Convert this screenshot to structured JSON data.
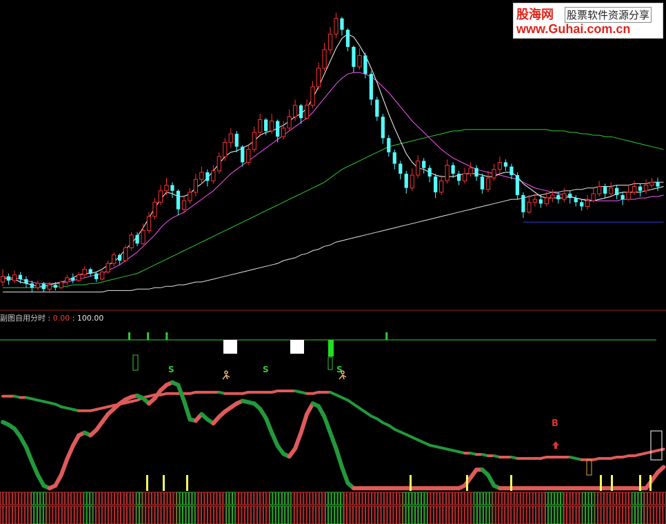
{
  "watermark": {
    "logo": "股海网",
    "slogan": "股票软件资源分享",
    "url": "www.Guhai.com.cn"
  },
  "sub_panel": {
    "name": "副图自用分时",
    "range_low": "0.00",
    "range_high": "100.00",
    "markers": {
      "buy": "B",
      "sell": "S"
    }
  },
  "colors": {
    "background": "#000000",
    "up_candle": "#ff3232",
    "down_candle": "#54fcfc",
    "ma_short": "#ffffff",
    "ma_mid": "#ff55ff",
    "ma_long": "#33cc33",
    "ma_longest": "#e6e6e6",
    "support_line": "#3333cc",
    "kdj_up": "#e05a5a",
    "kdj_down": "#22993a",
    "signal_bar": "#ffff66",
    "panel_divider": "#992222"
  },
  "chart_data": {
    "type": "candlestick",
    "candles": [
      [
        12.0,
        12.4,
        12.9,
        11.7
      ],
      [
        12.4,
        12.1,
        12.6,
        11.8
      ],
      [
        12.1,
        12.5,
        12.8,
        11.9
      ],
      [
        12.5,
        12.2,
        12.7,
        11.9
      ],
      [
        12.2,
        11.9,
        12.4,
        11.6
      ],
      [
        11.9,
        11.6,
        12.1,
        11.3
      ],
      [
        11.6,
        11.9,
        12.1,
        11.4
      ],
      [
        11.9,
        11.5,
        12.0,
        11.3
      ],
      [
        11.5,
        11.8,
        12.0,
        11.2
      ],
      [
        11.8,
        11.6,
        12.0,
        11.4
      ],
      [
        11.6,
        12.0,
        12.1,
        11.5
      ],
      [
        12.0,
        12.3,
        12.5,
        11.8
      ],
      [
        12.3,
        12.1,
        12.6,
        11.9
      ],
      [
        12.1,
        12.5,
        12.7,
        12.0
      ],
      [
        12.5,
        12.9,
        13.1,
        12.3
      ],
      [
        12.9,
        12.6,
        13.0,
        12.4
      ],
      [
        12.6,
        12.2,
        12.7,
        12.0
      ],
      [
        12.2,
        12.7,
        12.8,
        12.1
      ],
      [
        12.7,
        13.3,
        13.5,
        12.6
      ],
      [
        13.3,
        13.9,
        14.1,
        13.1
      ],
      [
        13.9,
        13.5,
        14.0,
        13.2
      ],
      [
        13.5,
        14.4,
        14.6,
        13.4
      ],
      [
        14.4,
        15.3,
        15.5,
        14.2
      ],
      [
        15.3,
        14.7,
        15.5,
        14.5
      ],
      [
        14.7,
        15.6,
        16.1,
        14.6
      ],
      [
        15.6,
        16.6,
        16.9,
        15.4
      ],
      [
        16.6,
        17.6,
        17.9,
        16.4
      ],
      [
        17.6,
        18.4,
        18.8,
        17.4
      ],
      [
        18.4,
        18.8,
        19.3,
        18.1
      ],
      [
        18.8,
        18.4,
        19.0,
        17.9
      ],
      [
        18.4,
        17.1,
        18.5,
        16.7
      ],
      [
        17.1,
        17.7,
        18.1,
        16.8
      ],
      [
        17.7,
        18.3,
        18.6,
        17.5
      ],
      [
        18.3,
        19.2,
        19.6,
        18.0
      ],
      [
        19.2,
        19.7,
        20.1,
        18.9
      ],
      [
        19.7,
        19.1,
        19.9,
        18.7
      ],
      [
        19.1,
        19.8,
        20.2,
        18.9
      ],
      [
        19.8,
        20.8,
        21.1,
        19.6
      ],
      [
        20.8,
        21.8,
        22.1,
        20.5
      ],
      [
        21.8,
        22.4,
        22.8,
        21.4
      ],
      [
        22.4,
        21.5,
        22.6,
        21.1
      ],
      [
        21.5,
        20.4,
        21.6,
        20.1
      ],
      [
        20.4,
        21.3,
        21.6,
        20.2
      ],
      [
        21.3,
        22.5,
        22.9,
        21.1
      ],
      [
        22.5,
        23.4,
        23.8,
        22.3
      ],
      [
        23.4,
        22.6,
        23.5,
        22.3
      ],
      [
        22.6,
        23.3,
        23.8,
        22.4
      ],
      [
        23.3,
        22.2,
        23.4,
        21.8
      ],
      [
        22.2,
        22.8,
        23.3,
        22.0
      ],
      [
        22.8,
        23.6,
        24.1,
        22.6
      ],
      [
        23.6,
        24.4,
        24.8,
        23.3
      ],
      [
        24.4,
        23.5,
        24.5,
        23.1
      ],
      [
        23.5,
        24.4,
        24.8,
        23.4
      ],
      [
        24.4,
        25.7,
        26.1,
        24.2
      ],
      [
        25.7,
        27.0,
        27.4,
        25.5
      ],
      [
        27.0,
        28.3,
        28.8,
        26.8
      ],
      [
        28.3,
        29.4,
        29.9,
        28.0
      ],
      [
        29.4,
        30.5,
        30.9,
        29.1
      ],
      [
        30.5,
        29.7,
        30.6,
        29.3
      ],
      [
        29.7,
        28.5,
        29.8,
        28.2
      ],
      [
        28.5,
        27.1,
        28.6,
        26.7
      ],
      [
        27.1,
        27.9,
        28.4,
        26.9
      ],
      [
        27.9,
        26.6,
        28.1,
        26.3
      ],
      [
        26.6,
        24.8,
        26.8,
        24.4
      ],
      [
        24.8,
        23.6,
        25.0,
        23.3
      ],
      [
        23.6,
        22.1,
        23.8,
        21.7
      ],
      [
        22.1,
        21.1,
        22.3,
        20.8
      ],
      [
        21.1,
        20.3,
        21.3,
        19.9
      ],
      [
        20.3,
        19.6,
        20.5,
        19.2
      ],
      [
        19.6,
        18.6,
        19.8,
        18.2
      ],
      [
        18.6,
        19.5,
        20.0,
        18.4
      ],
      [
        19.5,
        20.5,
        20.9,
        19.3
      ],
      [
        20.5,
        20.0,
        20.7,
        19.6
      ],
      [
        20.0,
        19.4,
        20.2,
        19.0
      ],
      [
        19.4,
        18.3,
        19.6,
        17.9
      ],
      [
        18.3,
        19.1,
        19.5,
        18.1
      ],
      [
        19.1,
        20.2,
        20.6,
        18.9
      ],
      [
        20.2,
        19.6,
        20.4,
        19.3
      ],
      [
        19.6,
        19.1,
        19.8,
        18.8
      ],
      [
        19.1,
        19.6,
        20.0,
        18.9
      ],
      [
        19.6,
        20.0,
        20.4,
        19.4
      ],
      [
        20.0,
        19.4,
        20.2,
        19.1
      ],
      [
        19.4,
        18.5,
        19.6,
        18.2
      ],
      [
        18.5,
        19.3,
        19.8,
        18.3
      ],
      [
        19.3,
        19.9,
        20.3,
        19.1
      ],
      [
        19.9,
        20.4,
        20.8,
        19.6
      ],
      [
        20.4,
        20.1,
        20.6,
        19.8
      ],
      [
        20.1,
        19.5,
        20.3,
        19.2
      ],
      [
        19.5,
        18.1,
        19.7,
        17.8
      ],
      [
        18.1,
        16.9,
        18.3,
        16.5
      ],
      [
        16.9,
        17.6,
        18.1,
        16.8
      ],
      [
        17.6,
        17.8,
        18.2,
        17.3
      ],
      [
        17.8,
        17.5,
        18.1,
        17.2
      ],
      [
        17.5,
        17.9,
        18.3,
        17.3
      ],
      [
        17.9,
        18.1,
        18.5,
        17.6
      ],
      [
        18.1,
        17.8,
        18.3,
        17.5
      ],
      [
        17.8,
        18.2,
        18.6,
        17.6
      ],
      [
        18.2,
        17.9,
        18.4,
        17.5
      ],
      [
        17.9,
        17.6,
        18.1,
        17.3
      ],
      [
        17.6,
        17.3,
        17.8,
        17.0
      ],
      [
        17.3,
        17.7,
        18.1,
        17.1
      ],
      [
        17.7,
        18.2,
        18.6,
        17.6
      ],
      [
        18.2,
        18.7,
        19.1,
        18.0
      ],
      [
        18.7,
        18.2,
        18.9,
        17.9
      ],
      [
        18.2,
        18.6,
        19.0,
        18.0
      ],
      [
        18.6,
        18.1,
        18.8,
        17.8
      ],
      [
        18.1,
        17.8,
        18.3,
        17.4
      ],
      [
        17.8,
        18.3,
        18.8,
        17.7
      ],
      [
        18.3,
        18.7,
        19.1,
        18.1
      ],
      [
        18.7,
        18.4,
        18.9,
        18.0
      ],
      [
        18.4,
        18.8,
        19.2,
        18.2
      ],
      [
        18.8,
        19.0,
        19.3,
        18.6
      ],
      [
        19.0,
        18.7,
        19.3,
        18.4
      ]
    ],
    "ma_short": [
      12.3,
      12.2,
      12.2,
      12.0,
      11.9,
      11.8,
      11.7,
      11.7,
      11.8,
      11.9,
      12.0,
      12.1,
      12.3,
      12.5,
      12.6,
      12.6,
      12.7,
      12.9,
      13.2,
      13.4,
      13.8,
      14.3,
      14.7,
      15.2,
      15.8,
      16.5,
      17.2,
      17.8,
      18.3,
      18.2,
      18.0,
      18.0,
      18.2,
      18.6,
      18.9,
      19.3,
      19.8,
      20.3,
      20.8,
      21.1,
      21.2,
      21.4,
      21.6,
      21.9,
      22.3,
      22.5,
      22.6,
      22.8,
      23.0,
      23.3,
      23.6,
      23.8,
      24.2,
      24.9,
      25.7,
      26.6,
      27.5,
      28.4,
      29.1,
      29.4,
      29.2,
      28.6,
      27.9,
      27.0,
      26.0,
      24.9,
      23.8,
      22.8,
      21.9,
      21.0,
      20.4,
      20.0,
      19.9,
      19.7,
      19.5,
      19.4,
      19.4,
      19.4,
      19.5,
      19.6,
      19.6,
      19.6,
      19.5,
      19.4,
      19.4,
      19.6,
      19.7,
      19.7,
      19.4,
      18.9,
      18.6,
      18.3,
      18.0,
      17.9,
      17.9,
      17.9,
      17.9,
      18.0,
      17.9,
      17.8,
      17.7,
      17.7,
      17.8,
      17.9,
      18.0,
      18.2,
      18.3,
      18.3,
      18.3,
      18.3,
      18.4,
      18.5,
      18.6,
      18.7
    ],
    "ma_mid": [
      12.4,
      12.3,
      12.3,
      12.2,
      12.1,
      12.0,
      11.9,
      11.9,
      11.9,
      11.9,
      11.9,
      12.0,
      12.1,
      12.2,
      12.3,
      12.4,
      12.5,
      12.6,
      12.8,
      13.0,
      13.2,
      13.5,
      13.8,
      14.1,
      14.5,
      14.9,
      15.3,
      15.8,
      16.2,
      16.5,
      16.7,
      16.9,
      17.2,
      17.5,
      17.8,
      18.1,
      18.4,
      18.8,
      19.2,
      19.6,
      19.9,
      20.2,
      20.5,
      20.8,
      21.1,
      21.4,
      21.7,
      22.0,
      22.3,
      22.6,
      22.9,
      23.2,
      23.5,
      23.9,
      24.4,
      24.9,
      25.4,
      25.9,
      26.3,
      26.6,
      26.7,
      26.7,
      26.6,
      26.4,
      26.1,
      25.7,
      25.3,
      24.8,
      24.3,
      23.8,
      23.3,
      22.9,
      22.5,
      22.1,
      21.7,
      21.3,
      21.0,
      20.7,
      20.5,
      20.3,
      20.1,
      19.9,
      19.8,
      19.7,
      19.6,
      19.5,
      19.4,
      19.3,
      19.2,
      19.0,
      18.8,
      18.6,
      18.5,
      18.4,
      18.3,
      18.2,
      18.1,
      18.0,
      17.9,
      17.8,
      17.8,
      17.7,
      17.7,
      17.7,
      17.7,
      17.7,
      17.8,
      17.8,
      17.8,
      17.9,
      17.9,
      18.0,
      18.0,
      18.1
    ],
    "ma_long": [
      11.6,
      11.6,
      11.6,
      11.6,
      11.6,
      11.6,
      11.6,
      11.6,
      11.7,
      11.7,
      11.7,
      11.7,
      11.8,
      11.8,
      11.8,
      11.9,
      11.9,
      12.0,
      12.1,
      12.2,
      12.3,
      12.4,
      12.5,
      12.6,
      12.8,
      13.0,
      13.2,
      13.4,
      13.6,
      13.8,
      14.0,
      14.2,
      14.4,
      14.6,
      14.8,
      15.0,
      15.2,
      15.4,
      15.6,
      15.8,
      16.0,
      16.2,
      16.4,
      16.6,
      16.8,
      17.0,
      17.2,
      17.4,
      17.6,
      17.8,
      18.0,
      18.2,
      18.4,
      18.6,
      18.8,
      19.0,
      19.3,
      19.6,
      19.9,
      20.1,
      20.3,
      20.5,
      20.7,
      20.9,
      21.1,
      21.3,
      21.5,
      21.6,
      21.7,
      21.8,
      21.9,
      22.0,
      22.1,
      22.2,
      22.3,
      22.4,
      22.5,
      22.6,
      22.6,
      22.7,
      22.7,
      22.7,
      22.7,
      22.7,
      22.7,
      22.7,
      22.7,
      22.7,
      22.7,
      22.7,
      22.7,
      22.7,
      22.7,
      22.7,
      22.6,
      22.6,
      22.6,
      22.5,
      22.5,
      22.4,
      22.4,
      22.3,
      22.3,
      22.2,
      22.2,
      22.1,
      22.0,
      21.9,
      21.8,
      21.7,
      21.6,
      21.5,
      21.4,
      21.3
    ],
    "ma_longest": [
      11.3,
      11.3,
      11.3,
      11.3,
      11.3,
      11.3,
      11.3,
      11.3,
      11.3,
      11.3,
      11.3,
      11.3,
      11.3,
      11.3,
      11.3,
      11.3,
      11.3,
      11.3,
      11.4,
      11.4,
      11.4,
      11.4,
      11.4,
      11.5,
      11.5,
      11.5,
      11.6,
      11.6,
      11.7,
      11.7,
      11.8,
      11.8,
      11.9,
      12.0,
      12.0,
      12.1,
      12.2,
      12.3,
      12.4,
      12.5,
      12.6,
      12.7,
      12.8,
      12.9,
      13.0,
      13.1,
      13.2,
      13.3,
      13.5,
      13.6,
      13.7,
      13.9,
      14.0,
      14.2,
      14.3,
      14.5,
      14.6,
      14.8,
      14.9,
      15.0,
      15.1,
      15.2,
      15.3,
      15.4,
      15.5,
      15.6,
      15.7,
      15.8,
      15.9,
      16.0,
      16.1,
      16.2,
      16.3,
      16.4,
      16.5,
      16.6,
      16.7,
      16.8,
      16.9,
      17.0,
      17.1,
      17.2,
      17.3,
      17.4,
      17.5,
      17.6,
      17.7,
      17.8,
      17.8,
      17.9,
      18.0,
      18.1,
      18.1,
      18.2,
      18.3,
      18.3,
      18.4,
      18.4,
      18.5,
      18.5,
      18.6,
      18.6,
      18.7,
      18.7,
      18.7,
      18.8,
      18.8,
      18.8,
      18.9,
      18.9,
      18.9,
      19.0,
      19.0,
      19.0
    ],
    "support_line": {
      "start_index": 89,
      "end_index": 113,
      "value": 16.2
    },
    "ylim": [
      10.5,
      31.5
    ],
    "sub": {
      "ylim": [
        0,
        100
      ],
      "kdj": [
        52,
        50,
        47,
        41,
        33,
        22,
        12,
        4,
        2,
        4,
        12,
        24,
        34,
        42,
        44,
        42,
        46,
        52,
        58,
        62,
        66,
        69,
        71,
        72,
        70,
        66,
        70,
        76,
        80,
        82,
        80,
        68,
        54,
        53,
        58,
        54,
        51,
        56,
        60,
        63,
        66,
        68,
        67,
        66,
        62,
        55,
        44,
        34,
        28,
        26,
        32,
        44,
        58,
        66,
        64,
        56,
        44,
        32,
        18,
        6,
        2,
        2,
        2,
        2,
        2,
        2,
        2,
        2,
        2,
        2,
        2,
        2,
        2,
        2,
        2,
        2,
        2,
        2,
        2,
        4,
        10,
        16,
        16,
        12,
        4,
        2,
        2,
        2,
        2,
        2,
        2,
        2,
        2,
        2,
        2,
        2,
        2,
        2,
        2,
        2,
        2,
        2,
        2,
        2,
        2,
        2,
        2,
        2,
        2,
        2,
        2,
        8,
        14,
        18
      ],
      "kdj_upper": [
        83,
        83,
        83,
        82,
        82,
        81,
        80,
        79,
        78,
        77,
        75,
        74,
        73,
        72,
        72,
        72,
        73,
        74,
        75,
        76,
        77,
        78,
        79,
        80,
        82,
        83,
        84,
        84,
        85,
        85,
        85,
        85,
        85,
        86,
        86,
        86,
        86,
        86,
        85,
        85,
        85,
        85,
        86,
        86,
        86,
        86,
        86,
        87,
        87,
        87,
        87,
        86,
        85,
        85,
        86,
        86,
        86,
        84,
        82,
        80,
        77,
        74,
        71,
        68,
        66,
        63,
        61,
        58,
        56,
        54,
        52,
        50,
        48,
        46,
        45,
        44,
        43,
        42,
        41,
        40,
        40,
        39,
        39,
        38,
        38,
        37,
        37,
        37,
        36,
        36,
        36,
        36,
        36,
        37,
        37,
        37,
        37,
        37,
        36,
        35,
        35,
        35,
        36,
        36,
        36,
        37,
        37,
        38,
        38,
        39,
        40,
        41,
        42,
        43
      ],
      "panel_line": 100,
      "signals": [
        "S",
        "S",
        "S",
        "B"
      ]
    }
  }
}
